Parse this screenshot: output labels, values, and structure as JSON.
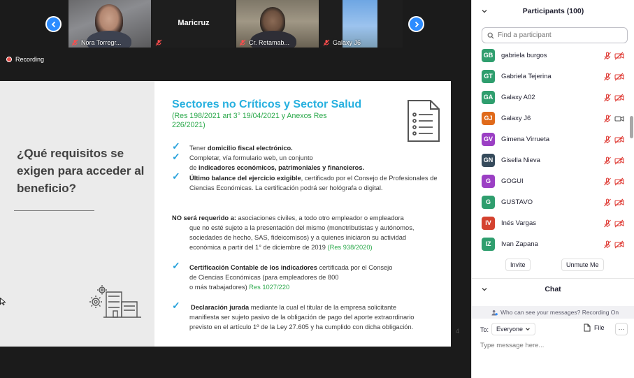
{
  "video_strip": {
    "tiles": [
      {
        "name": "Nora Torregr..."
      },
      {
        "name": "Maricruz"
      },
      {
        "name": "Cr. Retamab..."
      },
      {
        "name": "Galaxy J6"
      }
    ]
  },
  "recording": {
    "label": "Recording"
  },
  "slide": {
    "question": "¿Qué requisitos se exigen para acceder al beneficio?",
    "title": "Sectores no Críticos y Sector Salud",
    "subtitle": "(Res 198/2021 art 3° 19/04/2021 y Anexos Res 226/2021)",
    "b1_pre": "Tener ",
    "b1_bold": "domicilio fiscal electrónico.",
    "b2_line1": "Completar, vía formulario web, un conjunto",
    "b2_pre": "de ",
    "b2_bold": "indicadores económicos, patrimoniales y financieros.",
    "b3_bold": "Último balance del ejercicio exigible",
    "b3_rest": ", certificado por el Consejo de Profesionales de Ciencias Económicas. La certificación podrá ser hológrafa o digital.",
    "no_bold": "NO será requerido a:",
    "no_line1": " asociaciones civiles, a todo otro empleador o empleadora",
    "no_line2": "que no esté sujeto a la presentación del mismo (monotributistas y autónomos,",
    "no_line3": "sociedades de hecho, SAS, fideicomisos) y a quienes iniciaron su actividad",
    "no_line4": "económica a partir del 1° de diciembre de 2019 ",
    "no_green": "(Res 938/2020)",
    "b4_bold": "Certificación Contable de los indicadores",
    "b4_line1": " certificada por el Consejo",
    "b4_line2": "de Ciencias Económicas (para empleadores de 800",
    "b4_line3": "o más trabajadores) ",
    "b4_green": "Res 1027/220",
    "b5_bold": "Declaración jurada",
    "b5_line1": " mediante la cual el titular de la empresa solicitante",
    "b5_line2": "manifiesta ser sujeto pasivo de la obligación de pago del aporte extraordinario",
    "b5_line3": "previsto en el artículo 1º de la Ley 27.605 y ha cumplido con dicha obligación.",
    "page": "4",
    "colors": {
      "title": "#27b0df",
      "green": "#2aa84a",
      "check": "#2aa3dc"
    }
  },
  "participants": {
    "title": "Participants (100)",
    "search_placeholder": "Find a participant",
    "people": [
      {
        "initials": "GB",
        "name": "gabriela burgos",
        "color": "#2f9e6e",
        "video": "off"
      },
      {
        "initials": "GT",
        "name": "Gabriela Tejerina",
        "color": "#2f9e6e",
        "video": "off"
      },
      {
        "initials": "GA",
        "name": "Galaxy A02",
        "color": "#2f9e6e",
        "video": "off"
      },
      {
        "initials": "GJ",
        "name": "Galaxy J6",
        "color": "#e06a1b",
        "video": "on"
      },
      {
        "initials": "GV",
        "name": "Gimena Virrueta",
        "color": "#9b3fc4",
        "video": "off"
      },
      {
        "initials": "GN",
        "name": "Gisella Nieva",
        "color": "#364b5c",
        "video": "off"
      },
      {
        "initials": "G",
        "name": "GOGUI",
        "color": "#9b3fc4",
        "video": "off"
      },
      {
        "initials": "G",
        "name": "GUSTAVO",
        "color": "#2f9e6e",
        "video": "off"
      },
      {
        "initials": "IV",
        "name": "Inés Vargas",
        "color": "#d4422f",
        "video": "off"
      },
      {
        "initials": "IZ",
        "name": "Ivan Zapana",
        "color": "#2f9e6e",
        "video": "off"
      }
    ],
    "invite_label": "Invite",
    "unmute_label": "Unmute Me"
  },
  "chat": {
    "title": "Chat",
    "notice": "Who can see your messages? Recording On",
    "to_label": "To:",
    "recipient": "Everyone",
    "file_label": "File",
    "more_label": "···",
    "input_placeholder": "Type message here..."
  }
}
